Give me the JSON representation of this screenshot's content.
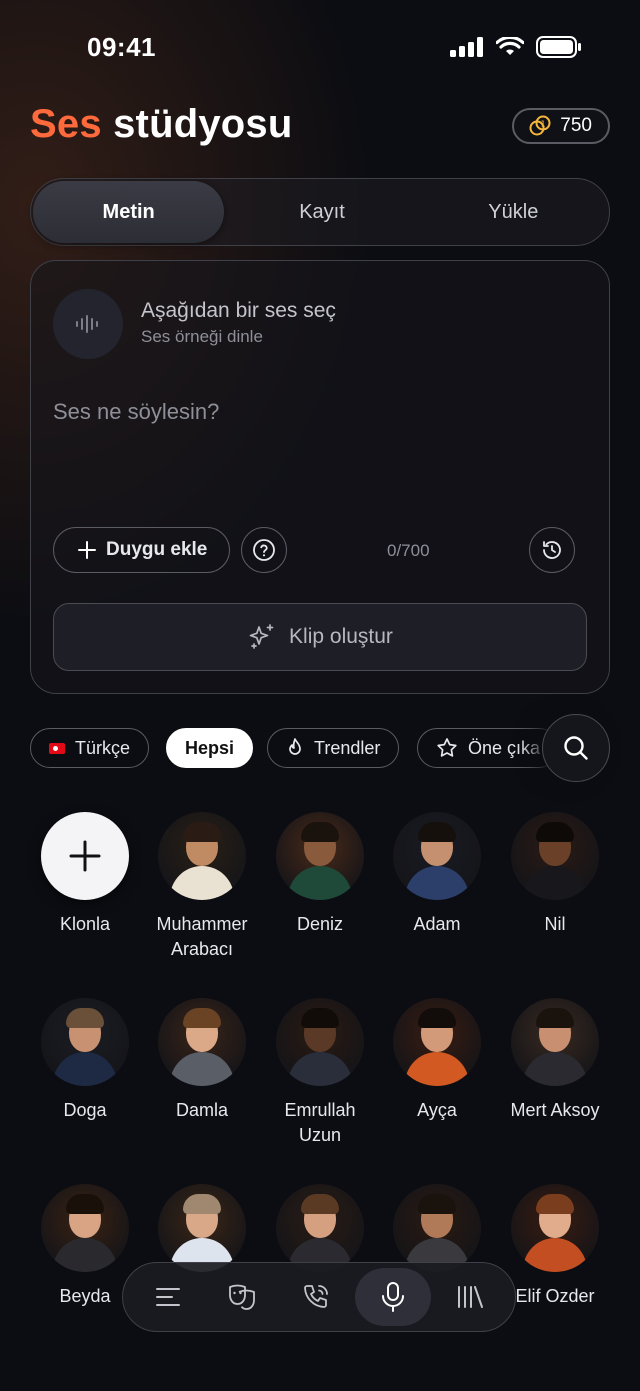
{
  "status": {
    "time": "09:41"
  },
  "header": {
    "title_accent": "Ses",
    "title_rest": "stüdyosu",
    "credits": "750"
  },
  "tabs": [
    {
      "label": "Metin",
      "active": true
    },
    {
      "label": "Kayıt",
      "active": false
    },
    {
      "label": "Yükle",
      "active": false
    }
  ],
  "editor": {
    "voice_title": "Aşağıdan bir ses seç",
    "voice_subtitle": "Ses örneği dinle",
    "placeholder": "Ses ne söylesin?",
    "emotion_button": "Duygu ekle",
    "counter": "0/700",
    "create_button": "Klip oluştur"
  },
  "filters": [
    {
      "label": "Türkçe",
      "icon": "flag-tr-icon"
    },
    {
      "label": "Hepsi",
      "selected": true
    },
    {
      "label": "Trendler",
      "icon": "flame-icon"
    },
    {
      "label": "Öne çıka",
      "icon": "star-icon"
    }
  ],
  "voices": [
    {
      "name": "Klonla",
      "type": "clone"
    },
    {
      "name": "Muhammer Arabacı",
      "skin": "#c08a62",
      "shirt": "#e9e2d2",
      "hair": "#2a1c14",
      "bg": "#2a2016"
    },
    {
      "name": "Deniz",
      "skin": "#8a5a3c",
      "shirt": "#1f4a3a",
      "hair": "#1a120c",
      "bg": "#4a2a18"
    },
    {
      "name": "Adam",
      "skin": "#c49070",
      "shirt": "#2b3f6a",
      "hair": "#15100c",
      "bg": "#1a1c24"
    },
    {
      "name": "Nil",
      "skin": "#6a4028",
      "shirt": "#18181c",
      "hair": "#0e0a08",
      "bg": "#2a1a14"
    },
    {
      "name": "Doga",
      "skin": "#c89272",
      "shirt": "#1e2a44",
      "hair": "#6a5038",
      "bg": "#1c1e24"
    },
    {
      "name": "Damla",
      "skin": "#dba888",
      "shirt": "#5a5e66",
      "hair": "#6a4224",
      "bg": "#3a2418"
    },
    {
      "name": "Emrullah Uzun",
      "skin": "#5a3a26",
      "shirt": "#2a2e3a",
      "hair": "#120c08",
      "bg": "#2a1a12"
    },
    {
      "name": "Ayça",
      "skin": "#d29a78",
      "shirt": "#d25a22",
      "hair": "#120c0a",
      "bg": "#3a1c10"
    },
    {
      "name": "Mert Aksoy",
      "skin": "#c89070",
      "shirt": "#2a2a30",
      "hair": "#1a120c",
      "bg": "#3a2a20"
    },
    {
      "name": "Beyda",
      "skin": "#d8a484",
      "shirt": "#2a2a2e",
      "hair": "#1a100a",
      "bg": "#3a2212"
    },
    {
      "name": "",
      "skin": "#d8a888",
      "shirt": "#dde4ee",
      "hair": "#a08870",
      "bg": "#3a2616"
    },
    {
      "name": "",
      "skin": "#d4a080",
      "shirt": "#2a2a30",
      "hair": "#5a3a22",
      "bg": "#2a1c14"
    },
    {
      "name": "",
      "skin": "#b07a58",
      "shirt": "#3a3a3e",
      "hair": "#1a120c",
      "bg": "#2a1a12"
    },
    {
      "name": "Elif Ozder",
      "skin": "#e0ac8c",
      "shirt": "#c24e22",
      "hair": "#7a3e1e",
      "bg": "#3a1c10"
    }
  ],
  "nav": [
    {
      "icon": "menu-icon"
    },
    {
      "icon": "masks-icon"
    },
    {
      "icon": "phone-icon"
    },
    {
      "icon": "microphone-icon",
      "active": true
    },
    {
      "icon": "library-icon"
    }
  ]
}
